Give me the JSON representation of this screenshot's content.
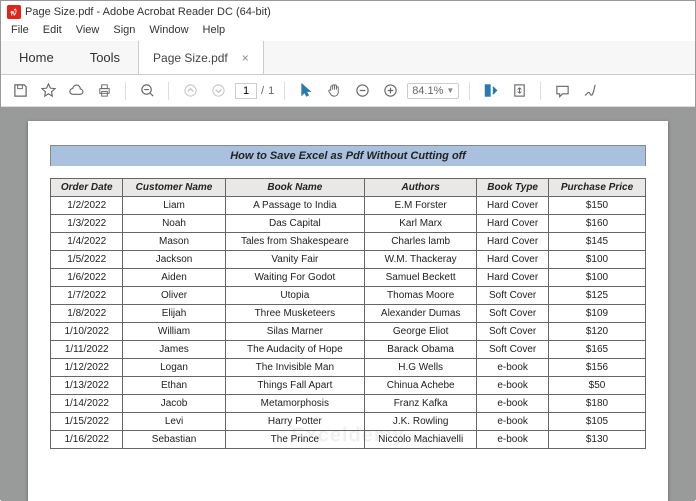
{
  "window": {
    "title": "Page Size.pdf - Adobe Acrobat Reader DC (64-bit)"
  },
  "menu": {
    "file": "File",
    "edit": "Edit",
    "view": "View",
    "sign": "Sign",
    "window": "Window",
    "help": "Help"
  },
  "tabs": {
    "home": "Home",
    "tools": "Tools",
    "doc": "Page Size.pdf",
    "close": "×"
  },
  "toolbar": {
    "page_current": "1",
    "page_sep": "/",
    "page_total": "1",
    "zoom_value": "84.1%"
  },
  "document": {
    "title": "How to Save Excel as Pdf Without Cutting off",
    "columns": [
      "Order Date",
      "Customer Name",
      "Book Name",
      "Authors",
      "Book Type",
      "Purchase Price"
    ],
    "rows": [
      [
        "1/2/2022",
        "Liam",
        "A Passage to India",
        "E.M Forster",
        "Hard Cover",
        "$150"
      ],
      [
        "1/3/2022",
        "Noah",
        "Das Capital",
        "Karl Marx",
        "Hard Cover",
        "$160"
      ],
      [
        "1/4/2022",
        "Mason",
        "Tales from Shakespeare",
        "Charles lamb",
        "Hard Cover",
        "$145"
      ],
      [
        "1/5/2022",
        "Jackson",
        "Vanity Fair",
        "W.M. Thackeray",
        "Hard Cover",
        "$100"
      ],
      [
        "1/6/2022",
        "Aiden",
        "Waiting For Godot",
        "Samuel Beckett",
        "Hard Cover",
        "$100"
      ],
      [
        "1/7/2022",
        "Oliver",
        "Utopia",
        "Thomas Moore",
        "Soft Cover",
        "$125"
      ],
      [
        "1/8/2022",
        "Elijah",
        "Three Musketeers",
        "Alexander Dumas",
        "Soft Cover",
        "$109"
      ],
      [
        "1/10/2022",
        "William",
        "Silas Marner",
        "George Eliot",
        "Soft Cover",
        "$120"
      ],
      [
        "1/11/2022",
        "James",
        "The Audacity of Hope",
        "Barack Obama",
        "Soft Cover",
        "$165"
      ],
      [
        "1/12/2022",
        "Logan",
        "The Invisible Man",
        "H.G Wells",
        "e-book",
        "$156"
      ],
      [
        "1/13/2022",
        "Ethan",
        "Things Fall Apart",
        "Chinua Achebe",
        "e-book",
        "$50"
      ],
      [
        "1/14/2022",
        "Jacob",
        "Metamorphosis",
        "Franz Kafka",
        "e-book",
        "$180"
      ],
      [
        "1/15/2022",
        "Levi",
        "Harry Potter",
        "J.K. Rowling",
        "e-book",
        "$105"
      ],
      [
        "1/16/2022",
        "Sebastian",
        "The Prince",
        "Niccolo Machiavelli",
        "e-book",
        "$130"
      ]
    ]
  }
}
